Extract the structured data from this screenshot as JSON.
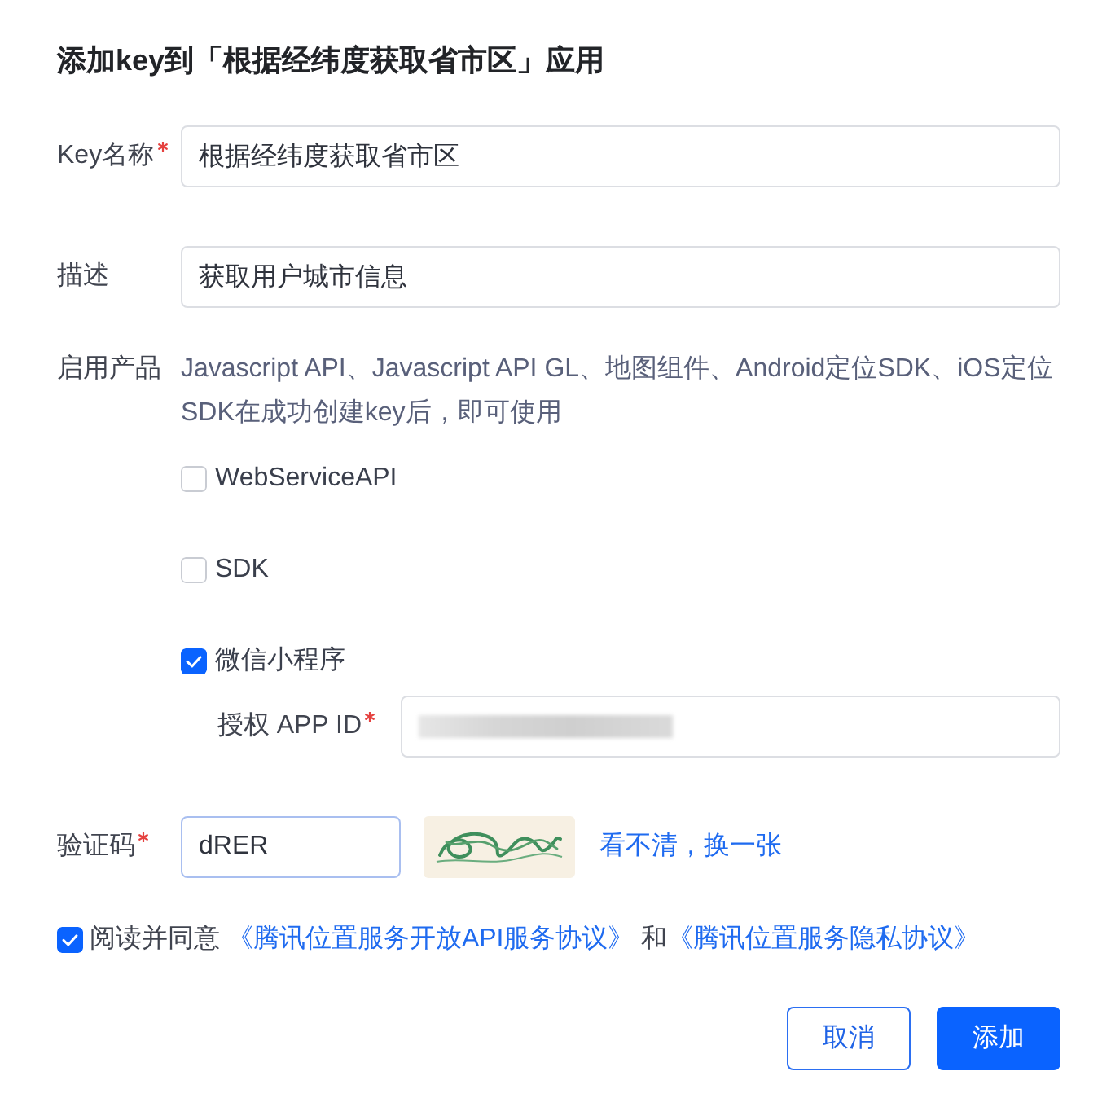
{
  "dialog": {
    "title": "添加key到「根据经纬度获取省市区」应用"
  },
  "fields": [
    {
      "label": "Key名称",
      "required": true,
      "value": "根据经纬度获取省市区"
    },
    {
      "label": "描述",
      "required": false,
      "value": "获取用户城市信息"
    }
  ],
  "products": {
    "label": "启用产品",
    "note": "Javascript API、Javascript API GL、地图组件、Android定位SDK、iOS定位SDK在成功创建key后，即可使用",
    "options": [
      {
        "label": "WebServiceAPI",
        "checked": false
      },
      {
        "label": "SDK",
        "checked": false
      },
      {
        "label": "微信小程序",
        "checked": true,
        "sub_field": {
          "label": "授权 APP ID",
          "required": true
        }
      }
    ]
  },
  "captcha": {
    "label": "验证码",
    "required": true,
    "value": "dRER",
    "refresh_link": "看不清，换一张"
  },
  "agreement": {
    "checked": true,
    "text": "阅读并同意",
    "links": [
      "《腾讯位置服务开放API服务协议》",
      "《腾讯位置服务隐私协议》"
    ],
    "joiner": "和"
  },
  "buttons": [
    {
      "label": "取消",
      "kind": "secondary"
    },
    {
      "label": "添加",
      "kind": "primary"
    }
  ]
}
